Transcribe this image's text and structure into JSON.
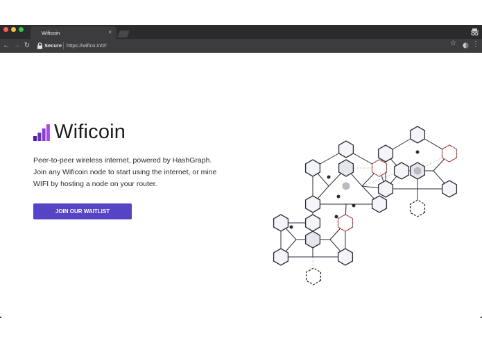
{
  "browser": {
    "tab_title": "Wificoin",
    "tab_close": "×",
    "security_label": "Secure",
    "url": "https://wifico.in/#/",
    "icons": [
      "close-icon",
      "back-icon",
      "forward-icon",
      "reload-icon",
      "lock-icon",
      "star-icon",
      "extension-icon",
      "menu-icon",
      "profile-icon"
    ]
  },
  "hero": {
    "brand": "Wificoin",
    "description": "Peer-to-peer wireless internet, powered by HashGraph. Join any Wificoin node to start using the internet, or mine WIFI by hosting a node on your router.",
    "cta_label": "JOIN OUR WAITLIST"
  },
  "colors": {
    "accent": "#5544c4",
    "logo_purple": "#7a3cc9",
    "node_dashed": "#d64545"
  }
}
